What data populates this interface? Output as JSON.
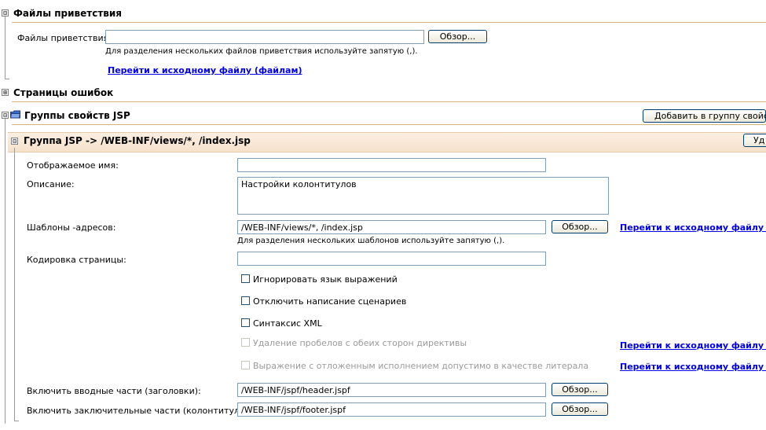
{
  "welcome_section": {
    "toggle": "⊟",
    "title": "Файлы приветствия",
    "field_label": "Файлы приветствия:",
    "field_value": "",
    "browse_label": "Обзор...",
    "hint": "Для разделения нескольких файлов приветствия используйте запятую (,).",
    "source_link": "Перейти к исходному файлу (файлам)"
  },
  "error_pages_section": {
    "toggle": "⊞",
    "title": "Страницы ошибок"
  },
  "jsp_groups_section": {
    "toggle": "⊟",
    "title": "Группы свойств JSP",
    "add_button": "Добавить в группу свойств"
  },
  "jsp_group": {
    "toggle": "⊟",
    "title": "Группа JSP -> /WEB-INF/views/*, /index.jsp",
    "remove_button": "Уд",
    "display_name_label": "Отображаемое имя:",
    "display_name_value": "",
    "description_label": "Описание:",
    "description_value": "Настройки колонтитулов",
    "url_patterns_label": "Шаблоны -адресов:",
    "url_patterns_value": "/WEB-INF/views/*, /index.jsp",
    "url_patterns_browse": "Обзор...",
    "url_patterns_link": "Перейти к исходному файлу (ф",
    "url_patterns_hint": "Для разделения нескольких шаблонов используйте запятую (,).",
    "encoding_label": "Кодировка страницы:",
    "encoding_value": "",
    "checkboxes": [
      {
        "label": "Игнорировать язык выражений",
        "checked": false,
        "disabled": false
      },
      {
        "label": "Отключить написание сценариев",
        "checked": false,
        "disabled": false
      },
      {
        "label": "Синтаксис XML",
        "checked": false,
        "disabled": false
      },
      {
        "label": "Удаление пробелов с обеих сторон директивы",
        "checked": false,
        "disabled": true
      },
      {
        "label": "Выражение с отложенным исполнением допустимо в качестве литерала",
        "checked": false,
        "disabled": true
      }
    ],
    "trim_link": "Перейти к исходному файлу (ф",
    "deferred_link": "Перейти к исходному файлу (ф",
    "prelude_label": "Включить вводные части (заголовки):",
    "prelude_value": "/WEB-INF/jspf/header.jspf",
    "prelude_browse": "Обзор...",
    "coda_label": "Включить заключительные части (колонтитулы):",
    "coda_value": "/WEB-INF/jspf/footer.jspf",
    "coda_browse": "Обзор..."
  },
  "colors": {
    "link": "#0000ee",
    "divider": "#d7b37a",
    "group_header_bg": "#f6e1cb",
    "field_border": "#7f9db9"
  }
}
